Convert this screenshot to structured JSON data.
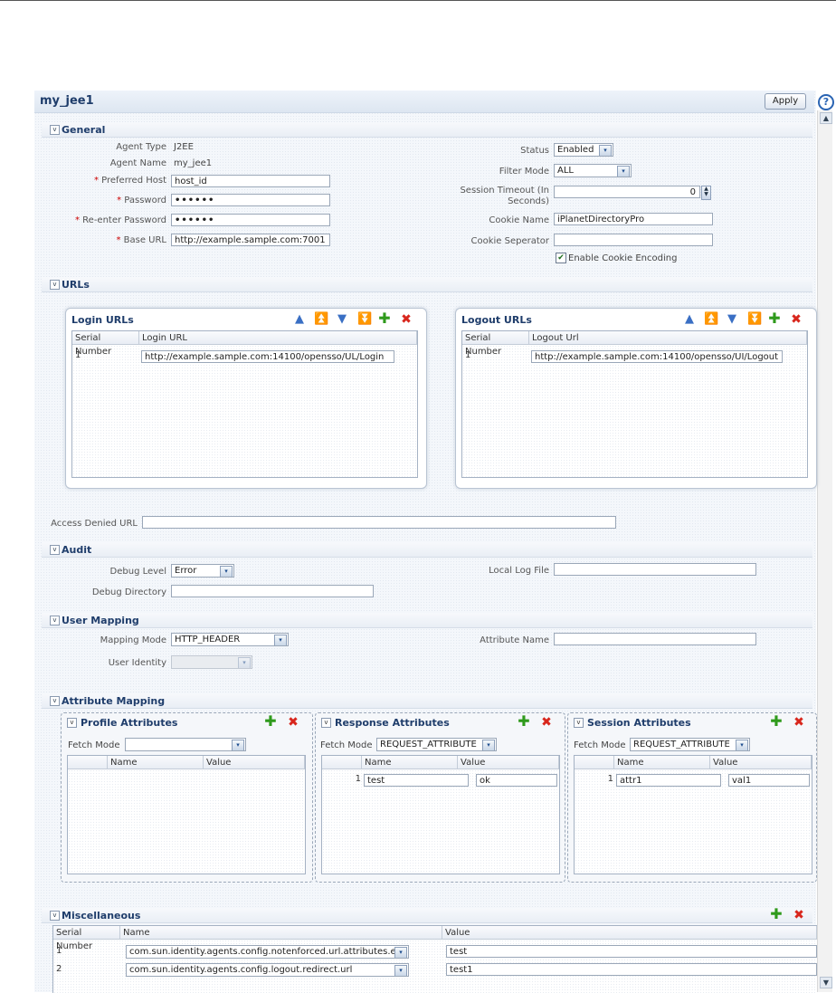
{
  "header": {
    "title": "my_jee1",
    "apply_label": "Apply",
    "help_label": "?"
  },
  "general": {
    "label": "General",
    "agent_type": {
      "label": "Agent Type",
      "value": "J2EE"
    },
    "agent_name": {
      "label": "Agent Name",
      "value": "my_jee1"
    },
    "preferred_host": {
      "label": "Preferred Host",
      "value": "host_id"
    },
    "password": {
      "label": "Password",
      "value": "••••••"
    },
    "reenter_password": {
      "label": "Re-enter Password",
      "value": "••••••"
    },
    "base_url": {
      "label": "Base URL",
      "value": "http://example.sample.com:7001"
    },
    "status": {
      "label": "Status",
      "value": "Enabled"
    },
    "filter_mode": {
      "label": "Filter Mode",
      "value": "ALL"
    },
    "session_timeout": {
      "label_line1": "Session Timeout (In",
      "label_line2": "Seconds)",
      "value": "0"
    },
    "cookie_name": {
      "label": "Cookie Name",
      "value": "iPlanetDirectoryPro"
    },
    "cookie_separator": {
      "label": "Cookie Seperator",
      "value": ""
    },
    "enable_cookie_encoding": {
      "label": "Enable Cookie Encoding",
      "checked": true
    },
    "required_mark": "*"
  },
  "urls": {
    "label": "URLs",
    "login": {
      "title": "Login URLs",
      "col_serial": "Serial Number",
      "col_url": "Login URL",
      "rows": [
        {
          "serial": "1",
          "url": "http://example.sample.com:14100/opensso/UL/Login"
        }
      ]
    },
    "logout": {
      "title": "Logout URLs",
      "col_serial": "Serial Number",
      "col_url": "Logout Url",
      "rows": [
        {
          "serial": "1",
          "url": "http://example.sample.com:14100/opensso/UI/Logout"
        }
      ]
    },
    "access_denied": {
      "label": "Access Denied URL",
      "value": ""
    }
  },
  "audit": {
    "label": "Audit",
    "debug_level": {
      "label": "Debug Level",
      "value": "Error"
    },
    "local_log_file": {
      "label": "Local Log File",
      "value": ""
    },
    "debug_directory": {
      "label": "Debug Directory",
      "value": ""
    }
  },
  "user_mapping": {
    "label": "User Mapping",
    "mapping_mode": {
      "label": "Mapping Mode",
      "value": "HTTP_HEADER"
    },
    "attribute_name": {
      "label": "Attribute Name",
      "value": ""
    },
    "user_identity": {
      "label": "User Identity",
      "value": ""
    }
  },
  "attribute_mapping": {
    "label": "Attribute Mapping",
    "fetch_mode_label": "Fetch Mode",
    "col_name": "Name",
    "col_value": "Value",
    "profile": {
      "title": "Profile Attributes",
      "fetch_mode": "",
      "rows": []
    },
    "response": {
      "title": "Response Attributes",
      "fetch_mode": "REQUEST_ATTRIBUTE",
      "rows": [
        {
          "index": "1",
          "name": "test",
          "value": "ok"
        }
      ]
    },
    "session": {
      "title": "Session Attributes",
      "fetch_mode": "REQUEST_ATTRIBUTE",
      "rows": [
        {
          "index": "1",
          "name": "attr1",
          "value": "val1"
        }
      ]
    }
  },
  "miscellaneous": {
    "label": "Miscellaneous",
    "col_serial": "Serial Number",
    "col_name": "Name",
    "col_value": "Value",
    "rows": [
      {
        "serial": "1",
        "name": "com.sun.identity.agents.config.notenforced.url.attributes.ei",
        "value": "test"
      },
      {
        "serial": "2",
        "name": "com.sun.identity.agents.config.logout.redirect.url",
        "value": "test1"
      }
    ]
  },
  "icons": {
    "move_up": "▲",
    "move_top": "⏫",
    "move_down": "▼",
    "move_bottom": "⏬",
    "add": "✚",
    "delete": "✖",
    "chevron": "▾",
    "collapse": "v",
    "check": "✔"
  }
}
